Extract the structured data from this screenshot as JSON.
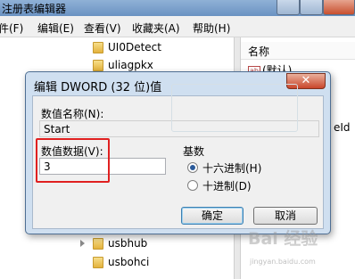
{
  "window": {
    "title": "注册表编辑器"
  },
  "menu": [
    {
      "label": "件(F)"
    },
    {
      "label": "编辑(E)"
    },
    {
      "label": "查看(V)"
    },
    {
      "label": "收藏夹(A)"
    },
    {
      "label": "帮助(H)"
    }
  ],
  "tree": {
    "items": [
      {
        "label": "UI0Detect"
      },
      {
        "label": "uliagpkx"
      },
      {
        "label": "usbhub"
      },
      {
        "label": "usbohci"
      }
    ]
  },
  "list": {
    "header": "名称",
    "rows": [
      {
        "label": "(默认)"
      },
      {
        "label": "eId"
      }
    ]
  },
  "dialog": {
    "title": "编辑 DWORD (32 位)值",
    "close_glyph": "✕",
    "value_name_label": "数值名称(N):",
    "value_name": "Start",
    "value_data_label": "数值数据(V):",
    "value_data": "3",
    "base_label": "基数",
    "radio_hex": "十六进制(H)",
    "radio_dec": "十进制(D)",
    "selected_base": "hex",
    "ok": "确定",
    "cancel": "取消"
  },
  "watermark": {
    "text": "Bai 经验",
    "sub": "jingyan.baidu.com"
  },
  "colors": {
    "highlight": "#e02020",
    "title_gradient": "#6a92c2"
  },
  "icons": [
    "folder-icon",
    "string-value-icon",
    "tree-expand-arrow-icon",
    "close-icon",
    "radio-button"
  ]
}
